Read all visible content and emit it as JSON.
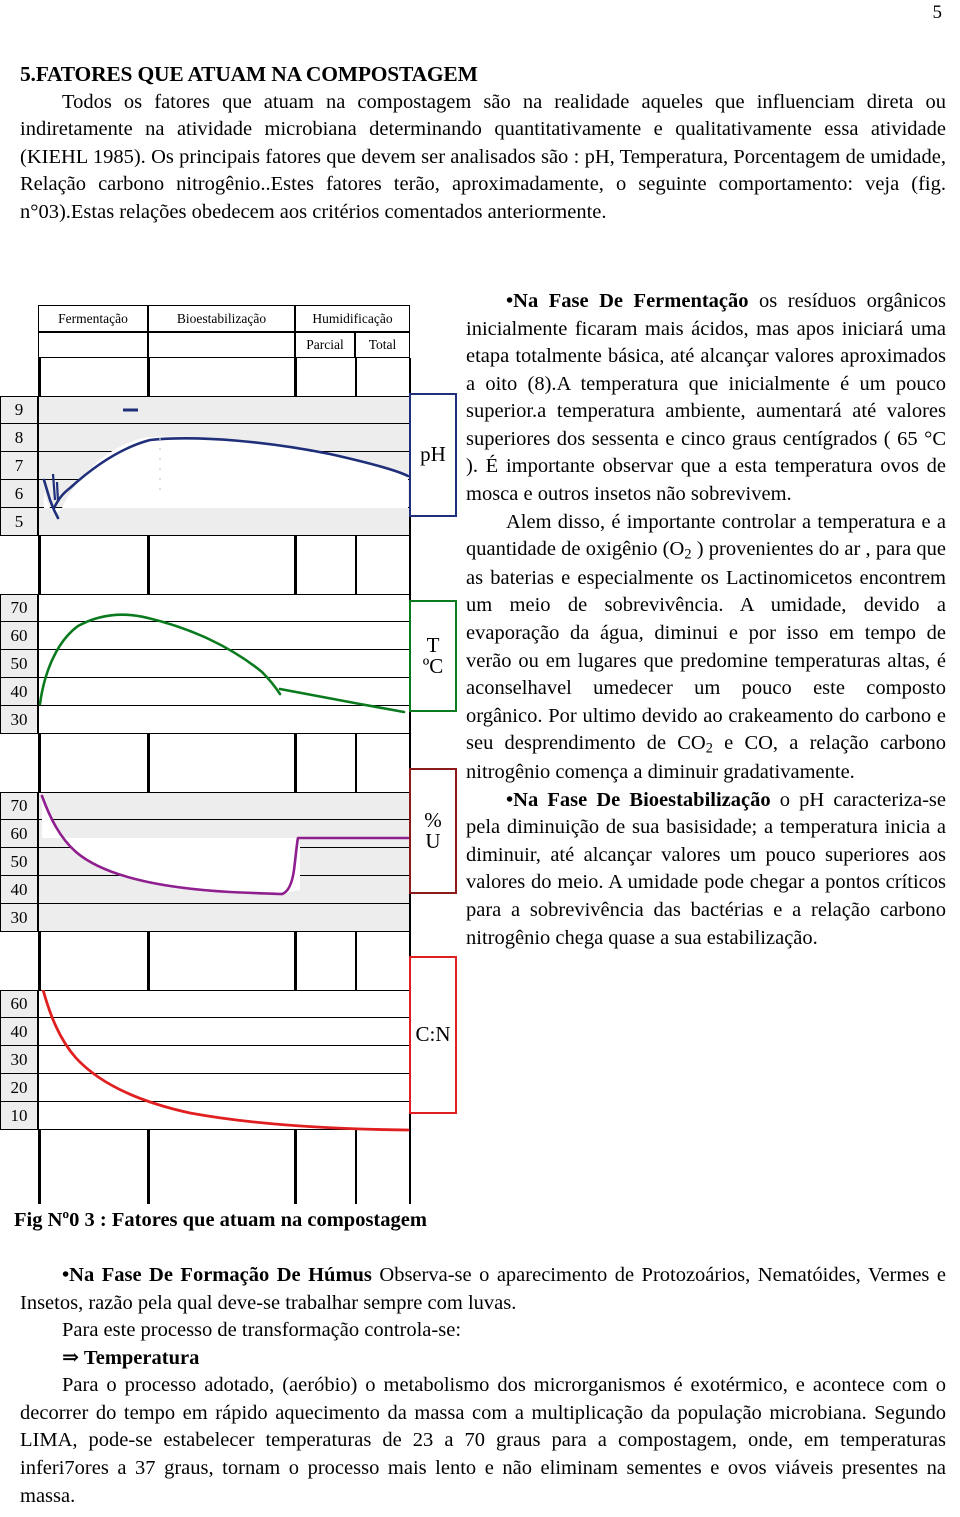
{
  "page": {
    "number": "5"
  },
  "heading": "5.FATORES QUE ATUAM NA COMPOSTAGEM",
  "intro": "Todos os fatores que atuam na compostagem são na realidade aqueles que influenciam direta ou indiretamente na atividade microbiana determinando quantitativamente e qualitativamente essa atividade (KIEHL 1985). Os  principais fatores que devem ser analisados   são : pH, Temperatura, Porcentagem de umidade, Relação carbono nitrogênio..Estes fatores terão, aproximadamente, o seguinte comportamento: veja (fig. n°03).Estas relações obedecem aos critérios comentados anteriormente.",
  "figure": {
    "caption": "Fig Nº0 3 : Fatores que atuam na compostagem",
    "phases": {
      "fermentacao": "Fermentação",
      "bioestabilizacao": "Bioestabilização",
      "humidificacao": "Humidificação",
      "parcial": "Parcial",
      "total": "Total"
    },
    "panel_labels": {
      "ph": "pH",
      "temp_line1": "T",
      "temp_line2": "ºC",
      "umid_line1": "%",
      "umid_line2": "U",
      "cn": "C:N"
    },
    "colors": {
      "ph": "#1f2f7a",
      "temp": "#0a7a1e",
      "umid": "#8f1f8f",
      "cn": "#e02020",
      "cn_box": "#e02020",
      "umid_box": "#8b1a1a",
      "grid": "#000000",
      "cell_fill": "#ededed"
    },
    "axis_ticks": {
      "ph": [
        "9",
        "8",
        "7",
        "6",
        "5"
      ],
      "temp": [
        "70",
        "60",
        "50",
        "40",
        "30"
      ],
      "umid": [
        "70",
        "60",
        "50",
        "40",
        "30"
      ],
      "cn": [
        "60",
        "40",
        "30",
        "20",
        "10"
      ]
    }
  },
  "chart_data": [
    {
      "type": "line",
      "title": "pH",
      "ylabel": "pH",
      "xlabel": "",
      "grid": true,
      "ylim": [
        4.5,
        9.5
      ],
      "yticks": [
        9,
        8,
        7,
        6,
        5
      ],
      "categories": [
        "Fermentação",
        "Bioestabilização",
        "Humidificação Parcial",
        "Humidificação Total"
      ],
      "series": [
        {
          "name": "pH",
          "color": "#1f2f7a",
          "x": [
            0,
            2,
            5,
            10,
            18,
            30,
            40,
            55,
            70,
            85,
            95,
            100
          ],
          "values": [
            6.5,
            6.0,
            6.6,
            7.4,
            7.9,
            8.2,
            8.25,
            8.1,
            7.95,
            7.6,
            7.2,
            7.0
          ]
        }
      ],
      "annotations": [
        "dash marker at pH 9 over Fermentação"
      ]
    },
    {
      "type": "line",
      "title": "T ºC",
      "ylabel": "T ºC",
      "xlabel": "",
      "grid": true,
      "ylim": [
        25,
        75
      ],
      "yticks": [
        70,
        60,
        50,
        40,
        30
      ],
      "categories": [
        "Fermentação",
        "Bioestabilização",
        "Humidificação Parcial",
        "Humidificação Total"
      ],
      "series": [
        {
          "name": "Temperatura",
          "color": "#0a7a1e",
          "x": [
            0,
            3,
            8,
            16,
            24,
            30,
            45,
            58,
            66,
            70,
            72,
            85,
            100
          ],
          "values": [
            35,
            45,
            55,
            63,
            67,
            68,
            66,
            60,
            52,
            41,
            40,
            38,
            36
          ]
        }
      ]
    },
    {
      "type": "line",
      "title": "% U",
      "ylabel": "% U",
      "xlabel": "",
      "grid": true,
      "ylim": [
        25,
        75
      ],
      "yticks": [
        70,
        60,
        50,
        40,
        30
      ],
      "categories": [
        "Fermentação",
        "Bioestabilização",
        "Humidificação Parcial",
        "Humidificação Total"
      ],
      "series": [
        {
          "name": "Umidade",
          "color": "#8f1f8f",
          "x": [
            0,
            3,
            8,
            14,
            22,
            32,
            45,
            58,
            66,
            70,
            74,
            80,
            100
          ],
          "values": [
            72,
            64,
            56,
            50,
            45,
            42,
            39,
            38,
            37.5,
            38,
            48,
            55,
            55
          ]
        }
      ]
    },
    {
      "type": "line",
      "title": "C:N",
      "ylabel": "C:N",
      "xlabel": "",
      "grid": true,
      "ylim": [
        0,
        65
      ],
      "yticks": [
        60,
        40,
        30,
        20,
        10
      ],
      "categories": [
        "Fermentação",
        "Bioestabilização",
        "Humidificação Parcial",
        "Humidificação Total"
      ],
      "series": [
        {
          "name": "Relação Carbono:Nitrogênio",
          "color": "#e02020",
          "x": [
            0,
            5,
            12,
            20,
            30,
            42,
            55,
            68,
            80,
            90,
            100
          ],
          "values": [
            62,
            46,
            34,
            26,
            20,
            15,
            11,
            8,
            5,
            3,
            2
          ]
        }
      ]
    }
  ],
  "right_column": {
    "p1_lead": "•Na Fase De Fermentação",
    "p1_rest": " os resíduos orgânicos  inicialmente ficaram mais ácidos, mas apos iniciará uma etapa totalmente básica, até alcançar valores aproximados a oito (8).A temperatura que inicialmente é um pouco superior.a temperatura ambiente, aumentará até valores superiores dos sessenta e cinco graus centígrados ( 65 °C ). É importante observar que a esta temperatura ovos de mosca e outros insetos não sobrevivem.",
    "p2_a": "Alem disso, é importante controlar a temperatura e a quantidade de oxigênio (O",
    "p2_sub1": "2",
    "p2_b": " ) provenientes do ar , para que as baterias e especialmente os Lactinomicetos encontrem um meio de sobrevivência. A umidade, devido a evaporação da água, diminui e por isso em tempo de verão ou em lugares que predomine temperaturas altas, é aconselhavel umedecer um pouco este composto orgânico. Por ultimo devido ao crakeamento do carbono e seu desprendimento de CO",
    "p2_sub2": "2",
    "p2_c": "  e CO, a relação carbono nitrogênio comença a diminuir gradativamente.",
    "p3_lead": "•Na Fase De Bioestabilização",
    "p3_rest": " o pH caracteriza-se pela diminuição de sua basisidade; a temperatura inicia a diminuir, até alcançar valores um pouco superiores aos valores do meio. A umidade pode chegar a pontos críticos para a sobrevivência das bactérias e a relação carbono nitrogênio chega quase a sua estabilização."
  },
  "bottom": {
    "p1_lead": "•Na Fase De Formação De Húmus",
    "p1_rest": " Observa-se o aparecimento de Protozoários, Nematóides, Vermes  e Insetos, razão pela qual deve-se trabalhar sempre com luvas.",
    "p2": "Para este processo de transformação controla-se:",
    "p3": "⇒ Temperatura",
    "p4": "Para o processo adotado, (aeróbio) o metabolismo dos microrganismos é exotérmico, e acontece com o decorrer do tempo em rápido aquecimento da massa com a multiplicação da população microbiana. Segundo LIMA, pode-se estabelecer temperaturas de 23 a 70 graus  para a compostagem, onde, em temperaturas inferi7ores a 37 graus, tornam o processo mais lento e não eliminam sementes e ovos viáveis presentes na massa."
  }
}
